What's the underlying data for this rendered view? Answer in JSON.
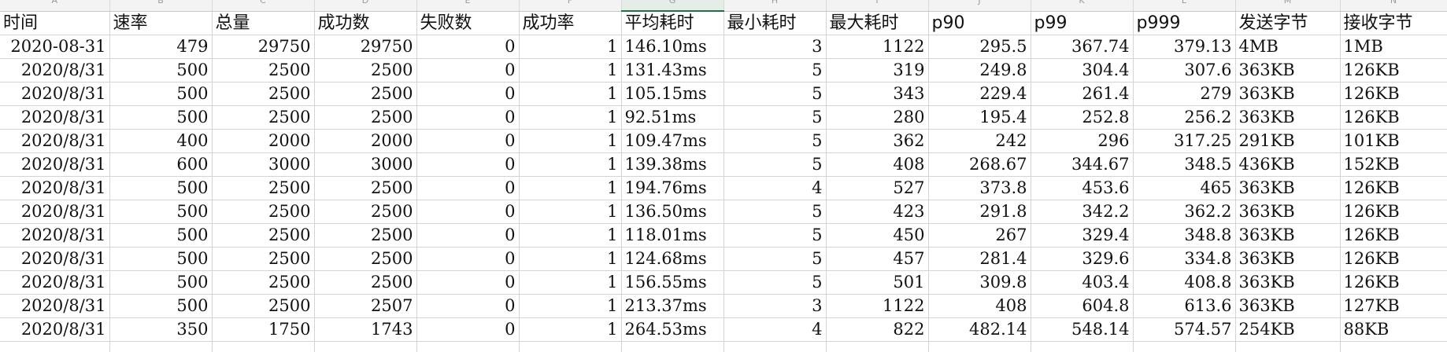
{
  "column_letters": [
    "A",
    "B",
    "C",
    "D",
    "E",
    "F",
    "G",
    "H",
    "I",
    "J",
    "K",
    "L",
    "M",
    "N"
  ],
  "active_column_index": 6,
  "headers": [
    "时间",
    "速率",
    "总量",
    "成功数",
    "失败数",
    "成功率",
    "平均耗时",
    "最小耗时",
    "最大耗时",
    "p90",
    "p99",
    "p999",
    "发送字节",
    "接收字节"
  ],
  "rows": [
    [
      "2020-08-31",
      "479",
      "29750",
      "29750",
      "0",
      "1",
      "146.10ms",
      "3",
      "1122",
      "295.5",
      "367.74",
      "379.13",
      "4MB",
      "1MB"
    ],
    [
      "2020/8/31",
      "500",
      "2500",
      "2500",
      "0",
      "1",
      "131.43ms",
      "5",
      "319",
      "249.8",
      "304.4",
      "307.6",
      "363KB",
      "126KB"
    ],
    [
      "2020/8/31",
      "500",
      "2500",
      "2500",
      "0",
      "1",
      "105.15ms",
      "5",
      "343",
      "229.4",
      "261.4",
      "279",
      "363KB",
      "126KB"
    ],
    [
      "2020/8/31",
      "500",
      "2500",
      "2500",
      "0",
      "1",
      "92.51ms",
      "5",
      "280",
      "195.4",
      "252.8",
      "256.2",
      "363KB",
      "126KB"
    ],
    [
      "2020/8/31",
      "400",
      "2000",
      "2000",
      "0",
      "1",
      "109.47ms",
      "5",
      "362",
      "242",
      "296",
      "317.25",
      "291KB",
      "101KB"
    ],
    [
      "2020/8/31",
      "600",
      "3000",
      "3000",
      "0",
      "1",
      "139.38ms",
      "5",
      "408",
      "268.67",
      "344.67",
      "348.5",
      "436KB",
      "152KB"
    ],
    [
      "2020/8/31",
      "500",
      "2500",
      "2500",
      "0",
      "1",
      "194.76ms",
      "4",
      "527",
      "373.8",
      "453.6",
      "465",
      "363KB",
      "126KB"
    ],
    [
      "2020/8/31",
      "500",
      "2500",
      "2500",
      "0",
      "1",
      "136.50ms",
      "5",
      "423",
      "291.8",
      "342.2",
      "362.2",
      "363KB",
      "126KB"
    ],
    [
      "2020/8/31",
      "500",
      "2500",
      "2500",
      "0",
      "1",
      "118.01ms",
      "5",
      "450",
      "267",
      "329.4",
      "348.8",
      "363KB",
      "126KB"
    ],
    [
      "2020/8/31",
      "500",
      "2500",
      "2500",
      "0",
      "1",
      "124.68ms",
      "5",
      "457",
      "281.4",
      "329.6",
      "334.8",
      "363KB",
      "126KB"
    ],
    [
      "2020/8/31",
      "500",
      "2500",
      "2500",
      "0",
      "1",
      "156.55ms",
      "5",
      "501",
      "309.8",
      "403.4",
      "408.8",
      "363KB",
      "126KB"
    ],
    [
      "2020/8/31",
      "500",
      "2500",
      "2507",
      "0",
      "1",
      "213.37ms",
      "3",
      "1122",
      "408",
      "604.8",
      "613.6",
      "363KB",
      "127KB"
    ],
    [
      "2020/8/31",
      "350",
      "1750",
      "1743",
      "0",
      "1",
      "264.53ms",
      "4",
      "822",
      "482.14",
      "548.14",
      "574.57",
      "254KB",
      "88KB"
    ]
  ],
  "colors": {
    "grid_line": "#d4d4d4",
    "active_column_accent": "#1e7145",
    "header_strip": "#f3f3f3"
  }
}
